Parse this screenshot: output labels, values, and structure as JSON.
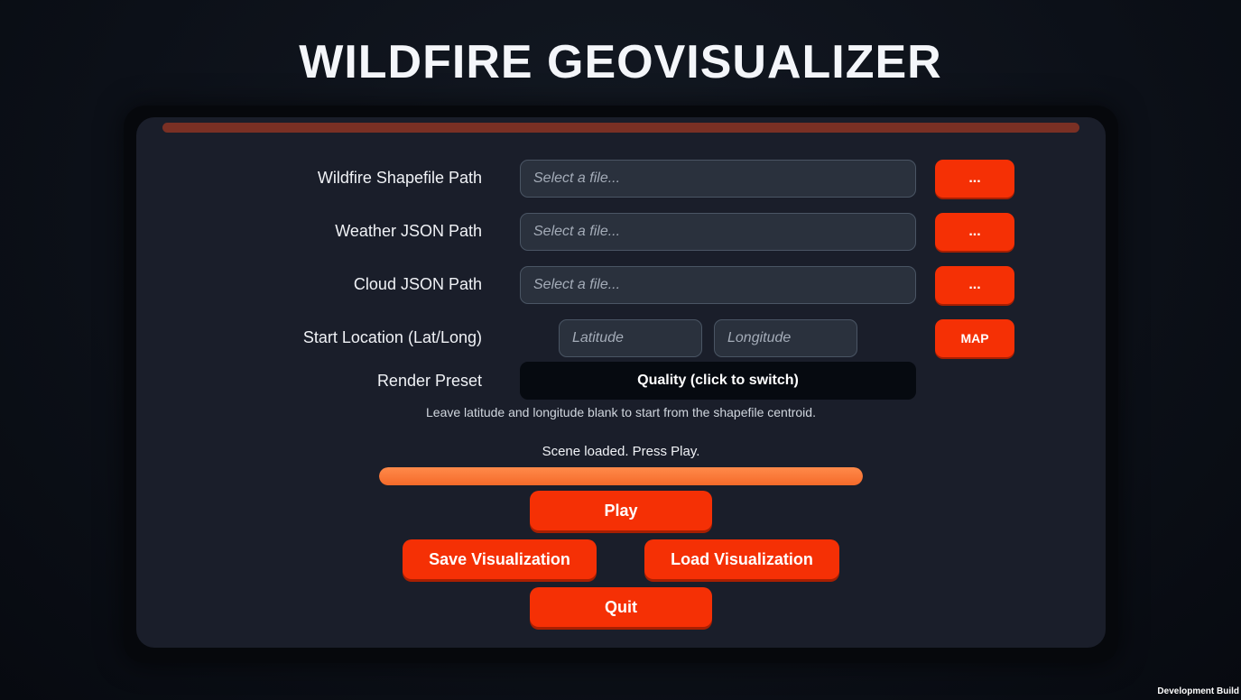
{
  "app": {
    "title": "WILDFIRE GEOVISUALIZER"
  },
  "form": {
    "shapefile": {
      "label": "Wildfire Shapefile Path",
      "value": "",
      "placeholder": "Select a file...",
      "browse_label": "..."
    },
    "weather": {
      "label": "Weather JSON Path",
      "value": "",
      "placeholder": "Select a file...",
      "browse_label": "..."
    },
    "cloud": {
      "label": "Cloud JSON Path",
      "value": "",
      "placeholder": "Select a file...",
      "browse_label": "..."
    },
    "start_location": {
      "label": "Start Location (Lat/Long)",
      "latitude_value": "",
      "latitude_placeholder": "Latitude",
      "longitude_value": "",
      "longitude_placeholder": "Longitude",
      "map_label": "MAP"
    },
    "render_preset": {
      "label": "Render Preset",
      "button_label": "Quality (click to switch)"
    },
    "hint": "Leave latitude and longitude blank to start from the shapefile centroid."
  },
  "status": {
    "message": "Scene loaded. Press Play.",
    "progress_percent": 100
  },
  "actions": {
    "play_label": "Play",
    "save_label": "Save Visualization",
    "load_label": "Load Visualization",
    "quit_label": "Quit"
  },
  "footer": {
    "build_label": "Development Build"
  },
  "colors": {
    "accent": "#f53005",
    "panel": "#1a1e2a",
    "progress": "#f56a2a",
    "top_bar": "#7a3024"
  }
}
